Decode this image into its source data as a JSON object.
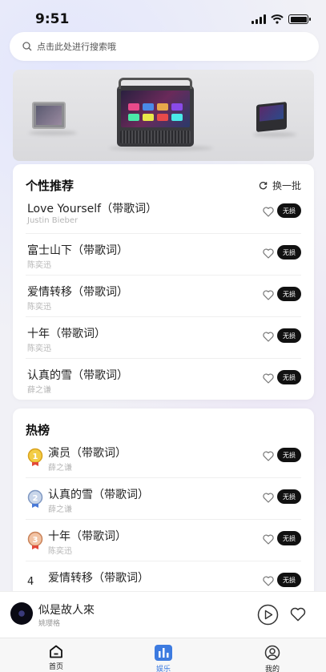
{
  "status_bar": {
    "time": "9:51"
  },
  "search": {
    "placeholder": "点击此处进行搜索哦"
  },
  "recommend": {
    "title": "个性推荐",
    "refresh_label": "换一批",
    "songs": [
      {
        "title": "Love Yourself（带歌词）",
        "artist": "Justin Bieber",
        "badge": "无损"
      },
      {
        "title": "富士山下（带歌词）",
        "artist": "陈奕迅",
        "badge": "无损"
      },
      {
        "title": "爱情转移（带歌词）",
        "artist": "陈奕迅",
        "badge": "无损"
      },
      {
        "title": "十年（带歌词）",
        "artist": "陈奕迅",
        "badge": "无损"
      },
      {
        "title": "认真的雪（带歌词）",
        "artist": "薛之谦",
        "badge": "无损"
      }
    ]
  },
  "hot": {
    "title": "热榜",
    "songs": [
      {
        "rank": "1",
        "title": "演员（带歌词）",
        "artist": "薛之谦",
        "badge": "无损",
        "medal": "gold"
      },
      {
        "rank": "2",
        "title": "认真的雪（带歌词）",
        "artist": "薛之谦",
        "badge": "无损",
        "medal": "silver"
      },
      {
        "rank": "3",
        "title": "十年（带歌词）",
        "artist": "陈奕迅",
        "badge": "无损",
        "medal": "bronze"
      },
      {
        "rank": "4",
        "title": "爱情转移（带歌词）",
        "artist": "",
        "badge": "无损",
        "medal": ""
      }
    ]
  },
  "player": {
    "title": "似是故人來",
    "artist": "姚瓔格"
  },
  "tabs": [
    {
      "label": "首页",
      "icon": "home-icon",
      "active": false
    },
    {
      "label": "娱乐",
      "icon": "chart-icon",
      "active": true
    },
    {
      "label": "我的",
      "icon": "user-icon",
      "active": false
    }
  ],
  "colors": {
    "accent": "#3d7be0",
    "badge_bg": "#111111",
    "gold": "#e8b62a",
    "silver": "#8aa3c8",
    "bronze": "#d49470"
  }
}
